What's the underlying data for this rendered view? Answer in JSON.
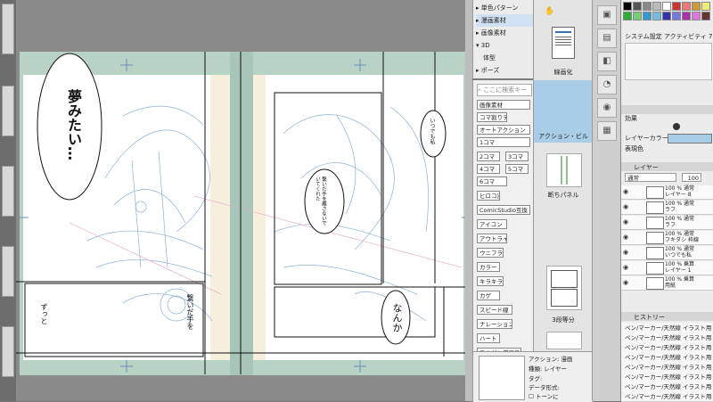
{
  "canvas": {
    "left_page": {
      "balloon_large": "夢みたい…",
      "side_text": "ずっと",
      "vertical_text": "繋いだ手を"
    },
    "right_page": {
      "balloon_top": "いつでも私",
      "balloon_mid": "繋いだ手を離さないでいてくれた",
      "balloon_bottom": "なんか"
    }
  },
  "tree": {
    "items": [
      "単色パターン",
      "漫画素材",
      "画像素材",
      "3D",
      "体型",
      "ポーズ"
    ]
  },
  "material": {
    "search_placeholder": "ここに検索キー",
    "tags": [
      "画像素材",
      "コマ割りテンプレート",
      "オートアクション",
      "1コマ",
      "2コマ",
      "3コマ",
      "4コマ",
      "5コマ",
      "6コマ",
      "ヒロコ漫画",
      "ComicStudio互換",
      "アイコン",
      "アウトライン",
      "ウニフラ",
      "カラー",
      "キラキラ",
      "カゲ",
      "スピード線",
      "ナレーション",
      "ハート",
      "フキダシ用画像",
      "フラッシュ",
      "フキダシ",
      "マルチ",
      "カラー",
      "手書き"
    ]
  },
  "material_preview": {
    "label_1": "線画化",
    "label_2": "アクション・ビル",
    "label_3": "断ちパネル",
    "label_4": "3段等分"
  },
  "properties": {
    "line1": "アクション: 漫画",
    "line2": "種類: レイヤー",
    "line3": "タグ:",
    "line4": "データ形式:",
    "checkbox": "トーンに"
  },
  "right_panel": {
    "navigator_title": "システム設定 アクティビティ 75%",
    "effect_label": "効果",
    "layer_color_label": "レイヤーカラー",
    "expression_label": "表現色",
    "layer_tab": "レイヤー",
    "blend_mode": "通常",
    "opacity": "100",
    "layers": [
      {
        "pct": "100 % 通常",
        "name": "レイヤー 8"
      },
      {
        "pct": "100 % 通常",
        "name": "ラフ"
      },
      {
        "pct": "100 % 通常",
        "name": "ラフ"
      },
      {
        "pct": "100 % 通常",
        "name": "フキダシ 枠線"
      },
      {
        "pct": "100 % 通常",
        "name": "いつでも私"
      },
      {
        "pct": "100 % 乗算",
        "name": "レイヤー 1"
      },
      {
        "pct": "100 % 乗算",
        "name": "用紙"
      }
    ],
    "history_tab": "ヒストリー",
    "history": [
      "ペン/マーカー/天然線 イラスト用",
      "ペン/マーカー/天然線 イラスト用",
      "ペン/マーカー/天然線 イラスト用",
      "ペン/マーカー/天然線 イラスト用",
      "ペン/マーカー/天然線 イラスト用",
      "ペン/マーカー/天然線 イラスト用",
      "ペン/マーカー/天然線 イラスト用",
      "ペン/マーカー/天然線 イラスト用"
    ]
  },
  "colors": {
    "bleed": "#b9d2c6",
    "sketch_blue": "#6a8fb8",
    "selected_blue": "#a9cde6"
  }
}
